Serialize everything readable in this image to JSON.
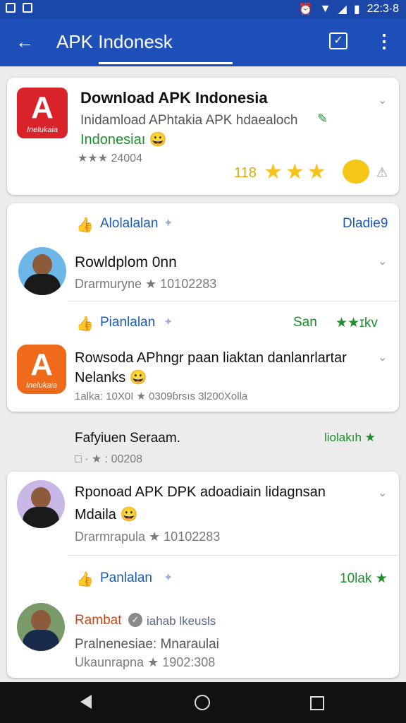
{
  "status": {
    "time": "22:3·8"
  },
  "appbar": {
    "title": "APK Indonesk"
  },
  "top_card": {
    "title": "Download APK Indonesia",
    "desc": "Inidamload APhtakia APK hdaealoch",
    "desc2": "Indonesiaı 😀",
    "meta": "24004",
    "rating_count": "118",
    "icon_text": "Inelukaia"
  },
  "section1": {
    "action_label": "Alolalalan",
    "right_label": "Dladie9",
    "item1_title": "Rowldplom 0nn",
    "item1_meta": "Drarmuryne ★  10102283",
    "action2_label": "Pianlalan",
    "action2_right": "San",
    "action2_stars": "★★ɪkv",
    "item2_title": "Rowsoda APhngr paan liaktan danlanrlartar",
    "item2_title2": "Nelanks 😀",
    "item2_meta": "1alka: 10X0I ★  0309ɓrsıs  3l200Xolla",
    "icon_text": "Inelukaia"
  },
  "standalone": {
    "title": "Fafyiuen Seraam.",
    "meta": "□ · ★ :  00208",
    "right": "liolakıh ★"
  },
  "section2": {
    "item1_title": "Rponoad APK DPK  adoadiain lidagnsan",
    "item1_title2": "Mdaila 😀",
    "item1_meta": "Drarmrapula ★  10102283",
    "action_label": "Panlalan",
    "action_right": "10lak ★",
    "item2_name": "Rambat",
    "item2_handle": "iahab  lkeusls",
    "item2_sub": "Pralnenesiae: Mnaraulai",
    "item2_meta": "Ukaunrapna ★  1902:308"
  }
}
